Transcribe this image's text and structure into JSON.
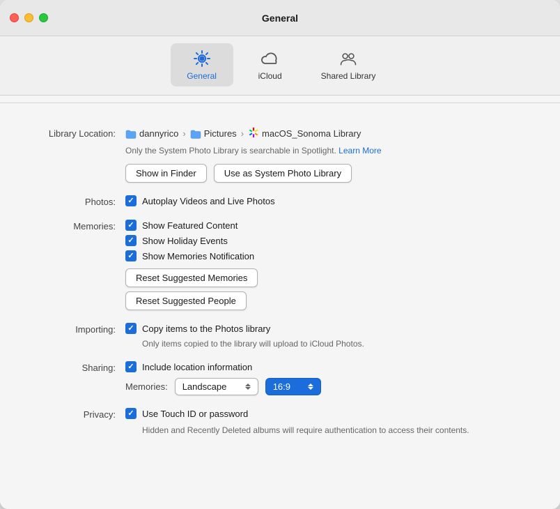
{
  "window": {
    "title": "General"
  },
  "tabs": [
    {
      "id": "general",
      "label": "General",
      "active": true
    },
    {
      "id": "icloud",
      "label": "iCloud",
      "active": false
    },
    {
      "id": "shared-library",
      "label": "Shared Library",
      "active": false
    }
  ],
  "library_location": {
    "label": "Library Location:",
    "path": [
      {
        "icon": "folder",
        "name": "dannyrico"
      },
      {
        "icon": "folder",
        "name": "Pictures"
      },
      {
        "icon": "photos",
        "name": "macOS_Sonoma Library"
      }
    ],
    "spotlight_note": "Only the System Photo Library is searchable in Spotlight.",
    "learn_more": "Learn More",
    "btn_finder": "Show in Finder",
    "btn_system": "Use as System Photo Library"
  },
  "photos_section": {
    "label": "Photos:",
    "items": [
      {
        "checked": true,
        "label": "Autoplay Videos and Live Photos"
      }
    ]
  },
  "memories_section": {
    "label": "Memories:",
    "items": [
      {
        "checked": true,
        "label": "Show Featured Content"
      },
      {
        "checked": true,
        "label": "Show Holiday Events"
      },
      {
        "checked": true,
        "label": "Show Memories Notification"
      }
    ],
    "btn_reset_memories": "Reset Suggested Memories",
    "btn_reset_people": "Reset Suggested People"
  },
  "importing_section": {
    "label": "Importing:",
    "items": [
      {
        "checked": true,
        "label": "Copy items to the Photos library"
      }
    ],
    "note": "Only items copied to the library will upload to iCloud Photos."
  },
  "sharing_section": {
    "label": "Sharing:",
    "items": [
      {
        "checked": true,
        "label": "Include location information"
      }
    ],
    "memories_label": "Memories:",
    "orientation_value": "Landscape",
    "ratio_value": "16:9"
  },
  "privacy_section": {
    "label": "Privacy:",
    "items": [
      {
        "checked": true,
        "label": "Use Touch ID or password"
      }
    ],
    "note": "Hidden and Recently Deleted albums will require authentication to access their contents."
  }
}
